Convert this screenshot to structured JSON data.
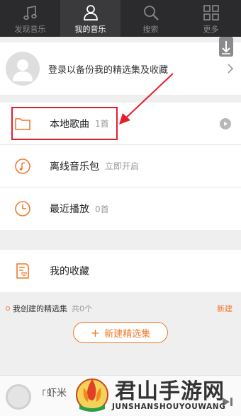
{
  "tabs": [
    {
      "label": "发现音乐",
      "icon": "music-note-icon",
      "active": false
    },
    {
      "label": "我的音乐",
      "icon": "person-icon",
      "active": true
    },
    {
      "label": "搜索",
      "icon": "search-icon",
      "active": false
    },
    {
      "label": "更多",
      "icon": "grid-icon",
      "active": false
    }
  ],
  "login": {
    "text": "登录以备份我的精选集及收藏"
  },
  "list": {
    "local": {
      "title": "本地歌曲",
      "count": "1首"
    },
    "offline": {
      "title": "离线音乐包",
      "status": "立即开启"
    },
    "recent": {
      "title": "最近播放",
      "count": "0首"
    },
    "favorites": {
      "title": "我的收藏"
    }
  },
  "selection": {
    "title": "我创建的精选集",
    "count": "共0个",
    "new_link": "新建",
    "new_button": "新建精选集"
  },
  "player": {
    "quote": "「",
    "text": "虾米"
  },
  "watermark": {
    "title": "君山手游网",
    "subtitle": "JUNSHANSHOUYOUWANG"
  },
  "colors": {
    "accent": "#ee7a2c",
    "highlight": "#e61e2a",
    "topbar": "#2b2b2d"
  }
}
